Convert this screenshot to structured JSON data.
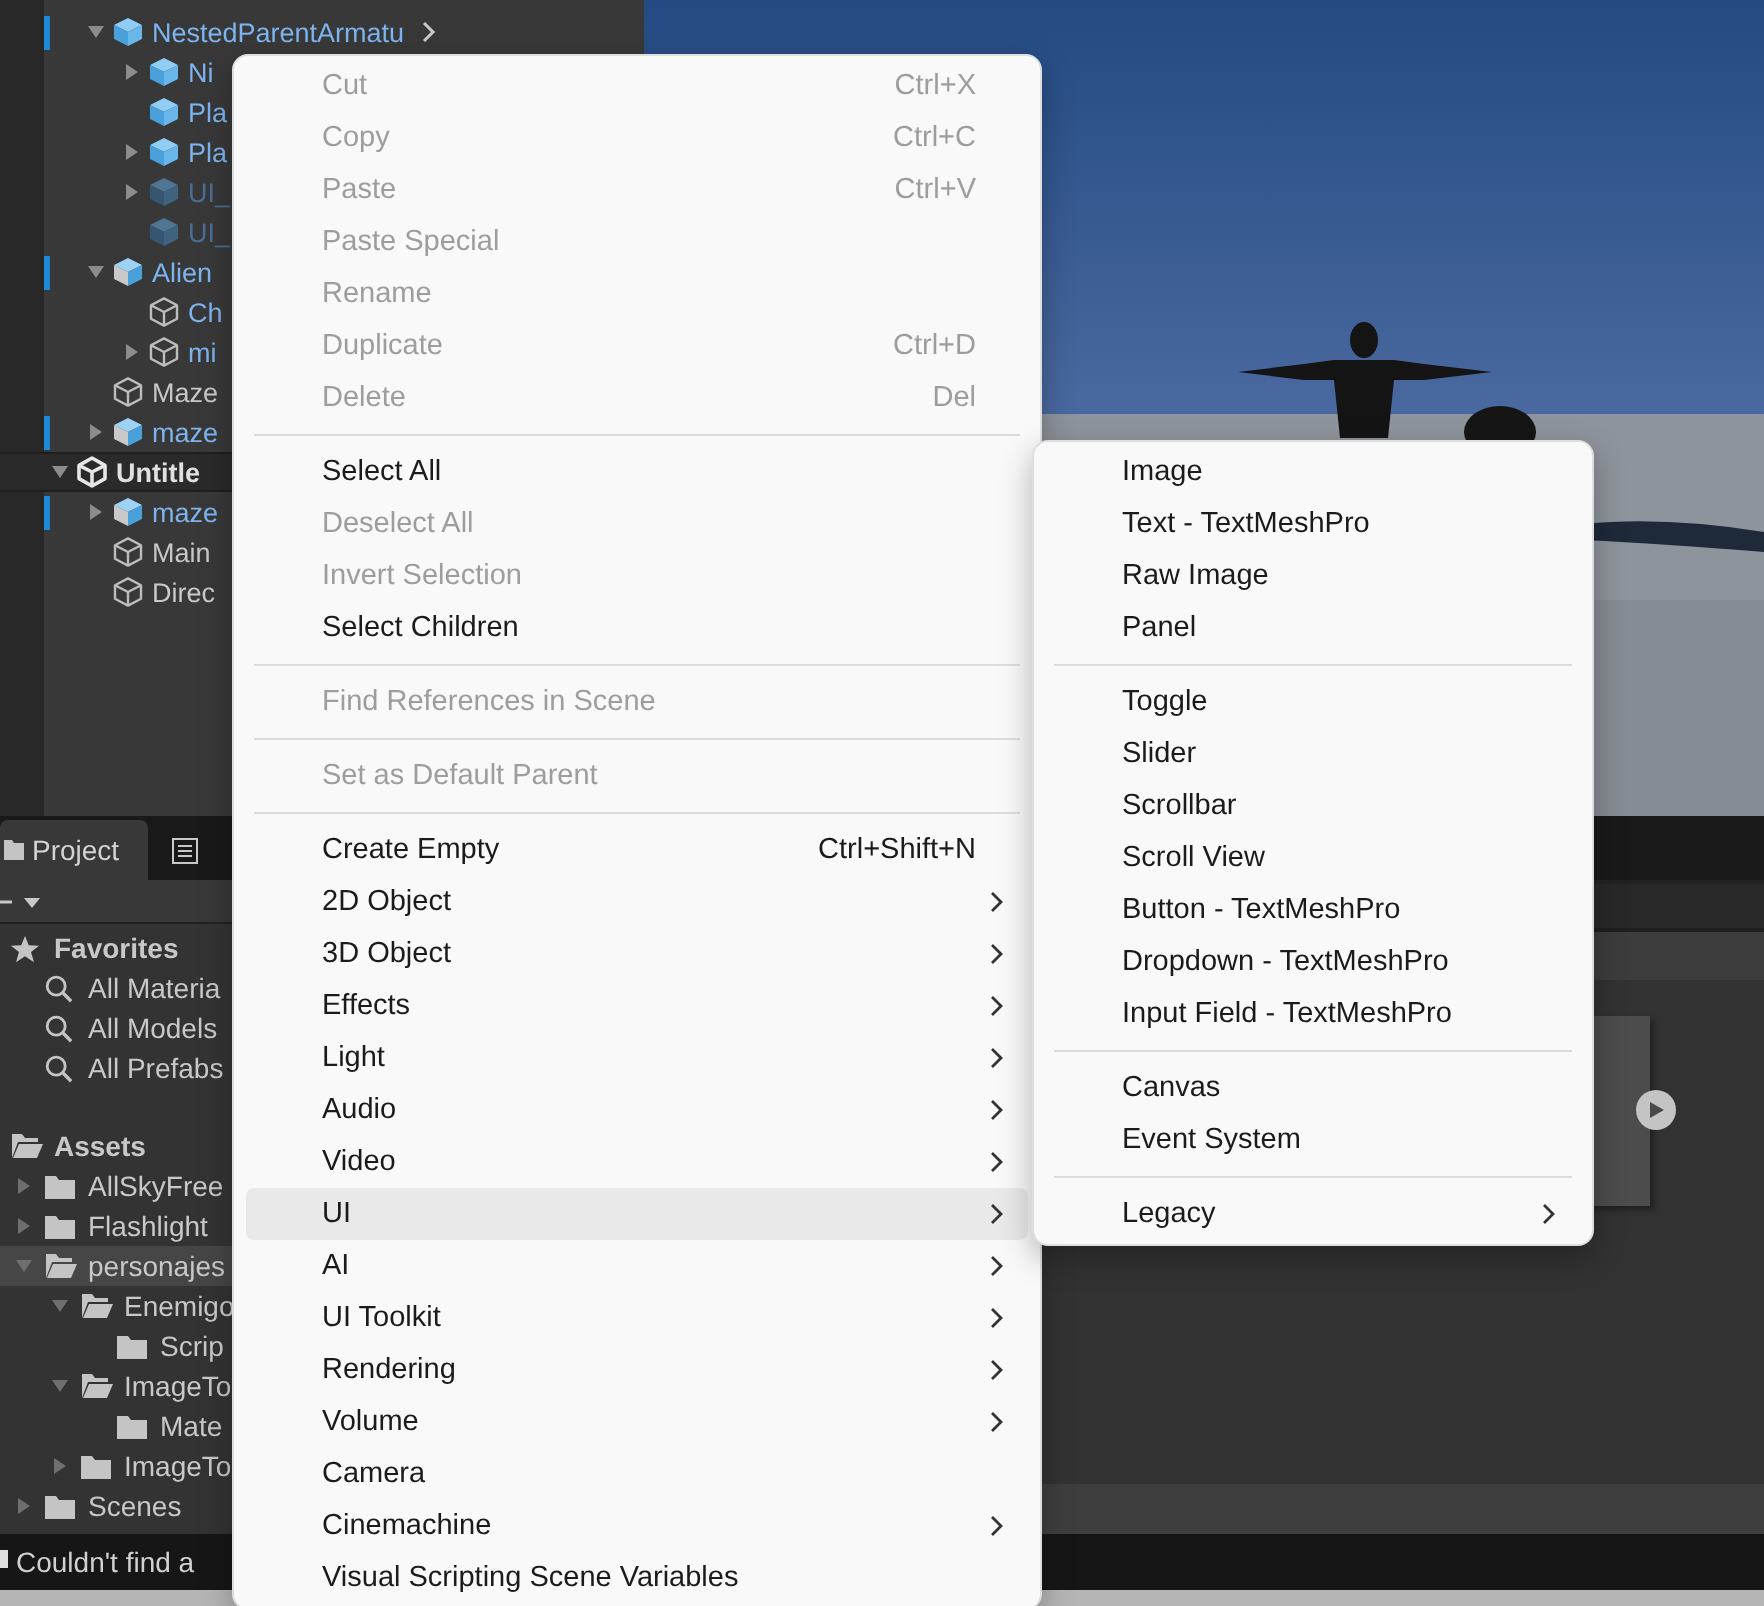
{
  "hierarchy": {
    "items": [
      {
        "label": "NestedParentArmatu",
        "kind": "prefab",
        "linked": true,
        "inactive": false,
        "marked": true,
        "open_button": true,
        "expanded": true,
        "children": [
          {
            "label": "Ni",
            "kind": "prefab",
            "linked": true,
            "inactive": false,
            "marked": false,
            "expanded": false
          },
          {
            "label": "Pla",
            "kind": "prefab",
            "linked": true,
            "inactive": false,
            "marked": false
          },
          {
            "label": "Pla",
            "kind": "prefab",
            "linked": true,
            "inactive": false,
            "marked": false,
            "expanded": false
          },
          {
            "label": "UI_",
            "kind": "prefab",
            "linked": true,
            "inactive": true,
            "marked": false,
            "expanded": false
          },
          {
            "label": "UI_",
            "kind": "prefab",
            "linked": true,
            "inactive": true,
            "marked": false
          }
        ]
      },
      {
        "label": "Alien",
        "kind": "model",
        "linked": true,
        "inactive": false,
        "marked": true,
        "expanded": true,
        "children": [
          {
            "label": "Ch",
            "kind": "object",
            "linked": true,
            "inactive": false,
            "marked": false
          },
          {
            "label": "mi",
            "kind": "object",
            "linked": true,
            "inactive": false,
            "marked": false,
            "expanded": false
          }
        ]
      },
      {
        "label": "Maze",
        "kind": "object",
        "linked": false,
        "inactive": false,
        "marked": false
      },
      {
        "label": "maze",
        "kind": "model",
        "linked": true,
        "inactive": false,
        "marked": true,
        "expanded": false
      }
    ],
    "scenes": [
      {
        "label": "Untitle",
        "kind": "scene",
        "linked": false,
        "inactive": false,
        "marked": false,
        "expanded": true,
        "children": [
          {
            "label": "maze",
            "kind": "model",
            "linked": true,
            "inactive": false,
            "marked": true,
            "expanded": false
          },
          {
            "label": "Main",
            "kind": "object",
            "linked": false,
            "inactive": false,
            "marked": false
          },
          {
            "label": "Direc",
            "kind": "object",
            "linked": false,
            "inactive": false,
            "marked": false
          }
        ]
      }
    ]
  },
  "project": {
    "tabs": [
      {
        "kind": "text",
        "label": "Project",
        "selected": true
      },
      {
        "kind": "icon",
        "selected": false
      }
    ],
    "tree": [
      {
        "label": "Favorites",
        "kind": "favorites",
        "selected": false,
        "children": [
          {
            "label": "All Materia",
            "kind": "search",
            "selected": false
          },
          {
            "label": "All Models",
            "kind": "search",
            "selected": false
          },
          {
            "label": "All Prefabs",
            "kind": "search",
            "selected": false
          }
        ]
      },
      {
        "label": "Assets",
        "kind": "folder",
        "selected": false,
        "gap": true,
        "children": [
          {
            "label": "AllSkyFree",
            "kind": "folder",
            "selected": false,
            "expanded": false
          },
          {
            "label": "Flashlight",
            "kind": "folder",
            "selected": false,
            "expanded": false
          },
          {
            "label": "personajes",
            "kind": "folder",
            "selected": true,
            "expanded": true,
            "children": [
              {
                "label": "Enemigo",
                "kind": "folder",
                "selected": false,
                "expanded": true,
                "children": [
                  {
                    "label": "Scrip",
                    "kind": "folder",
                    "selected": false
                  }
                ]
              },
              {
                "label": "ImageTo",
                "kind": "folder",
                "selected": false,
                "expanded": true,
                "children": [
                  {
                    "label": "Mate",
                    "kind": "folder",
                    "selected": false
                  }
                ]
              },
              {
                "label": "ImageTo",
                "kind": "folder",
                "selected": false,
                "expanded": false
              }
            ]
          },
          {
            "label": "Scenes",
            "kind": "folder",
            "selected": false,
            "expanded": false
          }
        ]
      }
    ]
  },
  "status_bar": {
    "message": "Couldn't find a"
  },
  "main_menu": {
    "items": [
      {
        "kind": "item",
        "label": "Cut",
        "shortcut": "Ctrl+X",
        "disabled": true,
        "selected": false
      },
      {
        "kind": "item",
        "label": "Copy",
        "shortcut": "Ctrl+C",
        "disabled": true,
        "selected": false
      },
      {
        "kind": "item",
        "label": "Paste",
        "shortcut": "Ctrl+V",
        "disabled": true,
        "selected": false
      },
      {
        "kind": "item",
        "label": "Paste Special",
        "disabled": true,
        "selected": false
      },
      {
        "kind": "item",
        "label": "Rename",
        "disabled": true,
        "selected": false
      },
      {
        "kind": "item",
        "label": "Duplicate",
        "shortcut": "Ctrl+D",
        "disabled": true,
        "selected": false
      },
      {
        "kind": "item",
        "label": "Delete",
        "shortcut": "Del",
        "disabled": true,
        "selected": false
      },
      {
        "kind": "separator"
      },
      {
        "kind": "item",
        "label": "Select All",
        "disabled": false,
        "selected": false
      },
      {
        "kind": "item",
        "label": "Deselect All",
        "disabled": true,
        "selected": false
      },
      {
        "kind": "item",
        "label": "Invert Selection",
        "disabled": true,
        "selected": false
      },
      {
        "kind": "item",
        "label": "Select Children",
        "disabled": false,
        "selected": false
      },
      {
        "kind": "separator"
      },
      {
        "kind": "item",
        "label": "Find References in Scene",
        "disabled": true,
        "selected": false
      },
      {
        "kind": "separator"
      },
      {
        "kind": "item",
        "label": "Set as Default Parent",
        "disabled": true,
        "selected": false
      },
      {
        "kind": "separator"
      },
      {
        "kind": "item",
        "label": "Create Empty",
        "shortcut": "Ctrl+Shift+N",
        "disabled": false,
        "selected": false
      },
      {
        "kind": "item",
        "label": "2D Object",
        "submenu": true,
        "disabled": false,
        "selected": false
      },
      {
        "kind": "item",
        "label": "3D Object",
        "submenu": true,
        "disabled": false,
        "selected": false
      },
      {
        "kind": "item",
        "label": "Effects",
        "submenu": true,
        "disabled": false,
        "selected": false
      },
      {
        "kind": "item",
        "label": "Light",
        "submenu": true,
        "disabled": false,
        "selected": false
      },
      {
        "kind": "item",
        "label": "Audio",
        "submenu": true,
        "disabled": false,
        "selected": false
      },
      {
        "kind": "item",
        "label": "Video",
        "submenu": true,
        "disabled": false,
        "selected": false
      },
      {
        "kind": "item",
        "label": "UI",
        "submenu": true,
        "disabled": false,
        "selected": true
      },
      {
        "kind": "item",
        "label": "AI",
        "submenu": true,
        "disabled": false,
        "selected": false
      },
      {
        "kind": "item",
        "label": "UI Toolkit",
        "submenu": true,
        "disabled": false,
        "selected": false
      },
      {
        "kind": "item",
        "label": "Rendering",
        "submenu": true,
        "disabled": false,
        "selected": false
      },
      {
        "kind": "item",
        "label": "Volume",
        "submenu": true,
        "disabled": false,
        "selected": false
      },
      {
        "kind": "item",
        "label": "Camera",
        "disabled": false,
        "selected": false
      },
      {
        "kind": "item",
        "label": "Cinemachine",
        "submenu": true,
        "disabled": false,
        "selected": false
      },
      {
        "kind": "item",
        "label": "Visual Scripting Scene Variables",
        "disabled": false,
        "selected": false
      }
    ]
  },
  "ui_submenu": {
    "items": [
      {
        "kind": "item",
        "label": "Image"
      },
      {
        "kind": "item",
        "label": "Text - TextMeshPro"
      },
      {
        "kind": "item",
        "label": "Raw Image"
      },
      {
        "kind": "item",
        "label": "Panel"
      },
      {
        "kind": "separator"
      },
      {
        "kind": "item",
        "label": "Toggle"
      },
      {
        "kind": "item",
        "label": "Slider"
      },
      {
        "kind": "item",
        "label": "Scrollbar"
      },
      {
        "kind": "item",
        "label": "Scroll View"
      },
      {
        "kind": "item",
        "label": "Button - TextMeshPro"
      },
      {
        "kind": "item",
        "label": "Dropdown - TextMeshPro"
      },
      {
        "kind": "item",
        "label": "Input Field - TextMeshPro"
      },
      {
        "kind": "separator"
      },
      {
        "kind": "item",
        "label": "Canvas"
      },
      {
        "kind": "item",
        "label": "Event System"
      },
      {
        "kind": "separator"
      },
      {
        "kind": "item",
        "label": "Legacy",
        "submenu": true
      }
    ]
  }
}
